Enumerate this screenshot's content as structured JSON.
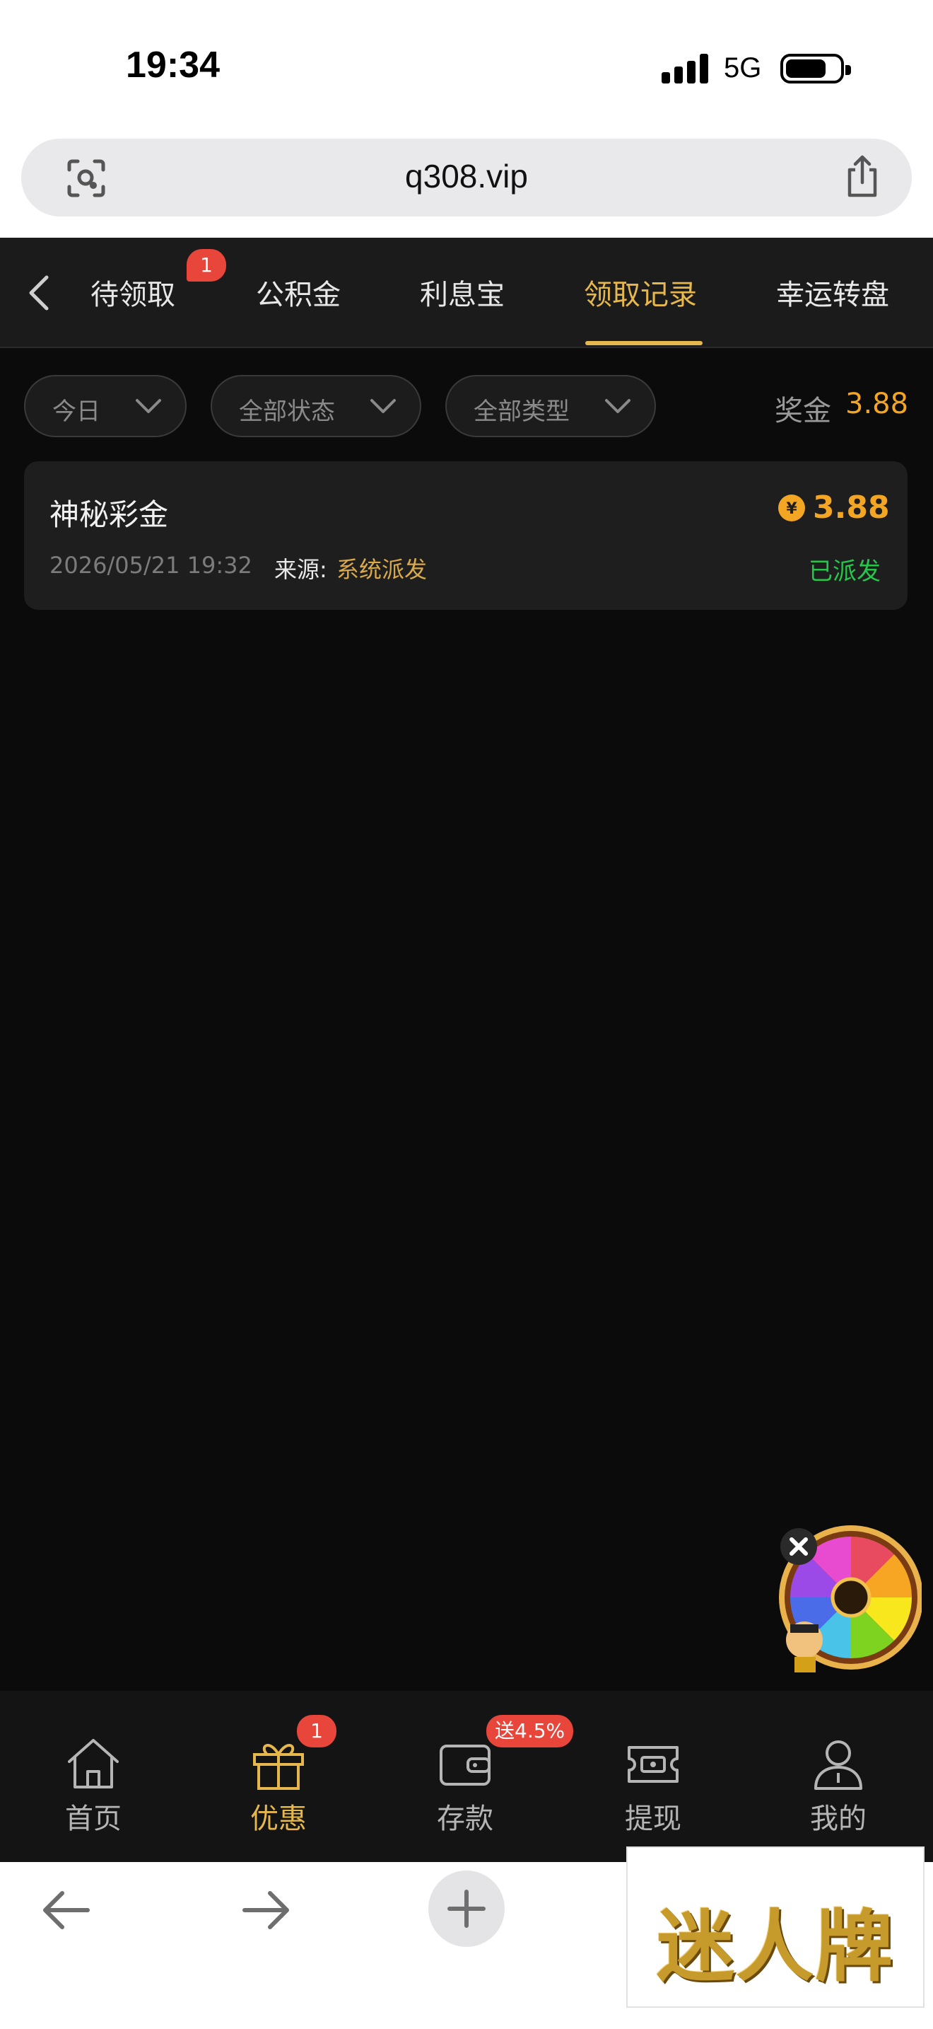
{
  "status_bar": {
    "time": "19:34",
    "network": "5G"
  },
  "browser": {
    "url": "q308.vip"
  },
  "tabs": {
    "items": [
      {
        "label": "待领取",
        "badge": "1"
      },
      {
        "label": "公积金"
      },
      {
        "label": "利息宝"
      },
      {
        "label": "领取记录",
        "active": true
      },
      {
        "label": "幸运转盘"
      }
    ]
  },
  "filters": {
    "date": "今日",
    "status": "全部状态",
    "type": "全部类型",
    "bonus_label": "奖金",
    "bonus_value": "3.88"
  },
  "records": [
    {
      "title": "神秘彩金",
      "amount": "3.88",
      "currency_symbol": "¥",
      "datetime": "2026/05/21 19:32",
      "source_label": "来源:",
      "source": "系统派发",
      "status": "已派发"
    }
  ],
  "bottom_nav": {
    "items": [
      {
        "label": "首页",
        "icon": "home-icon"
      },
      {
        "label": "优惠",
        "icon": "gift-icon",
        "badge": "1",
        "active": true
      },
      {
        "label": "存款",
        "icon": "wallet-icon",
        "badge": "送4.5%"
      },
      {
        "label": "提现",
        "icon": "ticket-icon"
      },
      {
        "label": "我的",
        "icon": "user-icon"
      }
    ]
  },
  "overlay": {
    "logo_text": "迷人牌"
  },
  "colors": {
    "accent": "#e6b74c",
    "amount": "#f2a623",
    "success": "#27c54b",
    "badge": "#e8463b"
  }
}
